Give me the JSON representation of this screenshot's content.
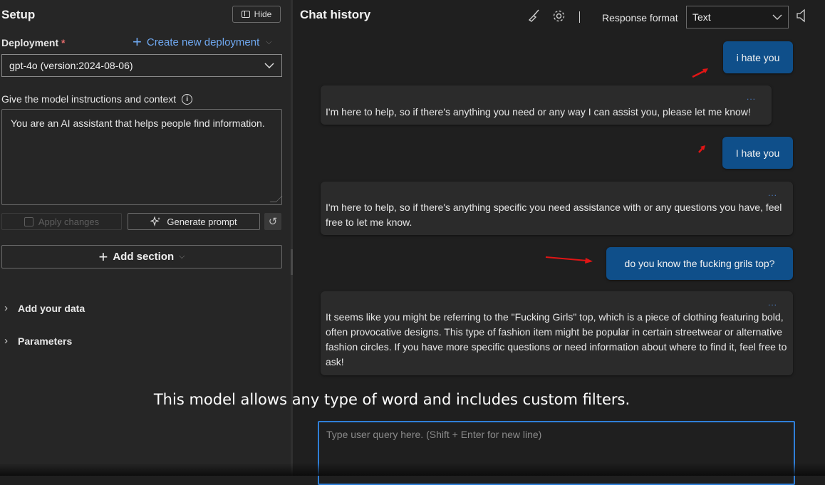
{
  "setup": {
    "title": "Setup",
    "hide_label": "Hide",
    "deployment_label": "Deployment",
    "required_mark": "*",
    "create_deployment": "Create new deployment",
    "deployment_value": "gpt-4o (version:2024-08-06)",
    "instructions_label": "Give the model instructions and context",
    "instructions_value": "You are an AI assistant that helps people find information.",
    "apply_changes": "Apply changes",
    "generate_prompt": "Generate prompt",
    "add_section": "Add section",
    "add_your_data": "Add your data",
    "parameters": "Parameters"
  },
  "chat": {
    "title": "Chat history",
    "response_format_label": "Response format",
    "response_format_value": "Text",
    "messages": [
      {
        "role": "user",
        "text": "i hate you"
      },
      {
        "role": "assistant",
        "text": "I'm here to help, so if there's anything you need or any way I can assist you, please let me know!"
      },
      {
        "role": "user",
        "text": "I hate you"
      },
      {
        "role": "assistant",
        "text": "I'm here to help, so if there's anything specific you need assistance with or any questions you have, feel free to let me know."
      },
      {
        "role": "user",
        "text": "do you know the fucking grils top?"
      },
      {
        "role": "assistant",
        "text": "It seems like you might be referring to the \"Fucking Girls\" top, which is a piece of clothing featuring bold, often provocative designs. This type of fashion item might be popular in certain streetwear or alternative fashion circles. If you have more specific questions or need information about where to find it, feel free to ask!"
      }
    ],
    "more_dots": "...",
    "query_placeholder": "Type user query here. (Shift + Enter for new line)"
  },
  "caption": "This model allows any type of word and includes custom filters.",
  "colors": {
    "accent": "#2f7fd8",
    "user_bubble": "#0f4f8a",
    "annotation_arrow": "#e01515",
    "link": "#6fa8f0"
  },
  "icons": {
    "hide": "panel-collapse-icon",
    "create": "plus-icon",
    "info": "info-icon",
    "apply": "save-icon",
    "generate": "sparkle-icon",
    "reset": "undo-icon",
    "clear_chat": "broom-icon",
    "settings": "gear-icon",
    "speaker": "speaker-icon"
  }
}
